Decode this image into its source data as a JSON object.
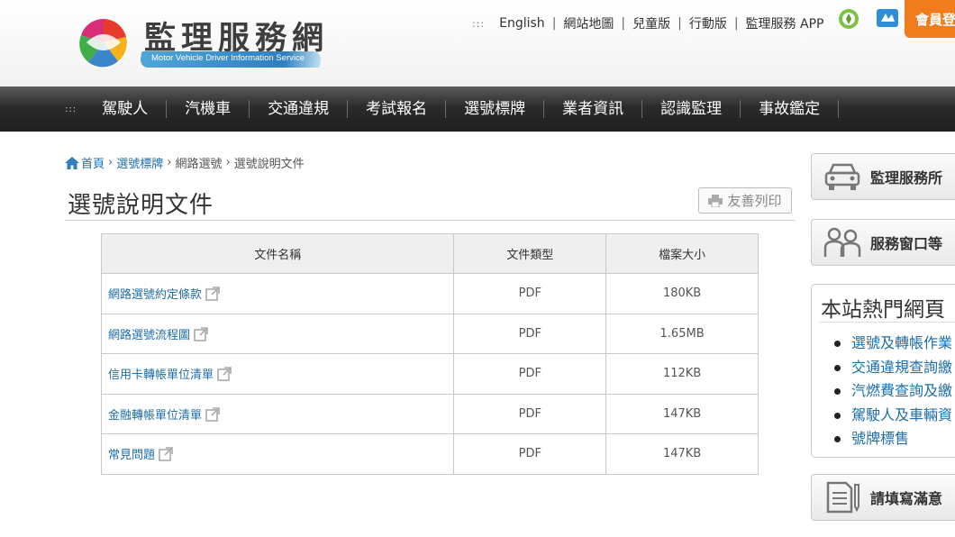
{
  "header": {
    "site_title": "監理服務網",
    "site_subtitle": "Motor Vehicle Driver Information Service",
    "top_links": [
      "English",
      "網站地圖",
      "兒童版",
      "行動版",
      "監理服務 APP"
    ],
    "top_links_marker": ":::",
    "member_button": "會員登"
  },
  "nav": {
    "marker": ":::",
    "items": [
      "駕駛人",
      "汽機車",
      "交通違規",
      "考試報名",
      "選號標牌",
      "業者資訊",
      "認識監理",
      "事故鑑定"
    ]
  },
  "breadcrumb": [
    "首頁",
    "選號標牌",
    "網路選號",
    "選號說明文件"
  ],
  "page_title": "選號說明文件",
  "print_button": "友善列印",
  "table": {
    "headers": [
      "文件名稱",
      "文件類型",
      "檔案大小"
    ],
    "rows": [
      {
        "name": "網路選號約定條款",
        "type": "PDF",
        "size": "180KB"
      },
      {
        "name": "網路選號流程圖",
        "type": "PDF",
        "size": "1.65MB"
      },
      {
        "name": "信用卡轉帳單位清單",
        "type": "PDF",
        "size": "112KB"
      },
      {
        "name": "金融轉帳單位清單",
        "type": "PDF",
        "size": "147KB"
      },
      {
        "name": "常見問題",
        "type": "PDF",
        "size": "147KB"
      }
    ]
  },
  "sidebar": {
    "cards": [
      "監理服務所",
      "服務窗口等",
      "請填寫滿意"
    ],
    "hot_title": "本站熱門網頁",
    "hot_links": [
      "選號及轉帳作業",
      "交通違規查詢繳",
      "汽燃費查詢及繳",
      "駕駛人及車輛資",
      "號牌標售"
    ]
  },
  "colors": {
    "link": "#1e6ea8",
    "nav_bg": "#2b2b2b",
    "member_button": "#ef7d1e"
  }
}
